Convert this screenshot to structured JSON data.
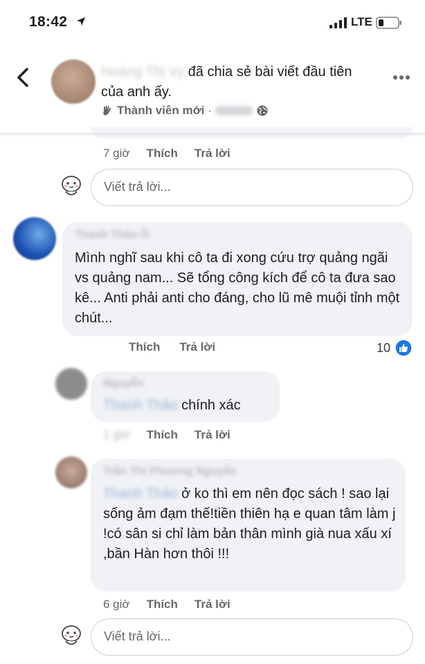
{
  "status_bar": {
    "time": "18:42",
    "network": "LTE"
  },
  "header": {
    "author_name": "Hoàng Thị Vy",
    "share_text": "đã chia sẻ bài viết đầu tiên của anh ấy.",
    "badge": "Thành viên mới",
    "separator": "·"
  },
  "first_comment": {
    "time": "7 giờ",
    "like_label": "Thích",
    "reply_label": "Trả lời",
    "reply_placeholder": "Viết trả lời..."
  },
  "comment_2": {
    "author": "Thanh Thảo Ô",
    "text": "Mình nghĩ sau khi cô ta đi xong cứu trợ quảng ngãi vs quảng nam... Sẽ tổng công kích để cô ta đưa sao kê... Anti phải anti cho đáng, cho lũ mê muội tỉnh một chút...",
    "like_label": "Thích",
    "reply_label": "Trả lời",
    "reaction_count": "10"
  },
  "reply_1": {
    "author": "Nguyễn",
    "mention": "Thanh Thảo",
    "text": "chính xác",
    "time": "1 giờ",
    "like_label": "Thích",
    "reply_label": "Trả lời"
  },
  "reply_2": {
    "author": "Trần Thị Phương Nguyễn",
    "mention": "Thanh Thảo",
    "text_line1": "ở ko thì em nên đọc sách !",
    "text_rest": "sao lại sống ảm đạm thế!tiền thiên hạ e quan tâm làm j !có sân si chỉ làm bản thân mình già nua xấu xí ,bần Hàn hơn thôi !!!",
    "time": "6 giờ",
    "like_label": "Thích",
    "reply_label": "Trả lời"
  },
  "bottom_reply": {
    "reply_placeholder": "Viết trả lời..."
  },
  "colors": {
    "like_blue": "#1877f2",
    "bubble_gray": "#f0f2f5",
    "meta_gray": "#65676b"
  }
}
